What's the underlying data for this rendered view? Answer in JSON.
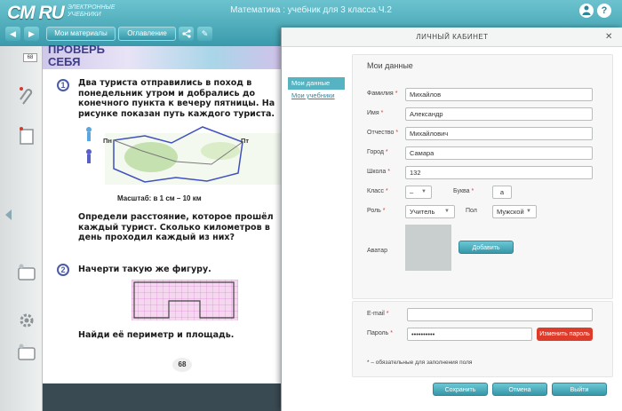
{
  "app": {
    "logo": "СМ RU",
    "logo_sub": "ЭЛЕКТРОННЫЕ УЧЕБНИКИ",
    "title": "Математика : учебник для 3 класса.Ч.2",
    "user_icon": "user-icon",
    "help_icon": "help-icon",
    "help_glyph": "?"
  },
  "toolbar": {
    "back_glyph": "◀",
    "forward_glyph": "▶",
    "my_materials": "Мои материалы",
    "contents": "Оглавление",
    "share_glyph": "<",
    "tools_glyph": "✎"
  },
  "sidebar": {
    "page_badge": "68"
  },
  "book": {
    "header": "ПРОВЕРЬ СЕБЯ",
    "task1_num": "1",
    "task1_text": "Два туриста отправились в поход в понедельник утром и добрались до конечного пункта к вечеру пятницы. На рисунке показан путь каждого туриста.",
    "label_start": "Пн",
    "label_end": "Пт",
    "scale": "Масштаб: в 1 см – 10 км",
    "task1_q": "Определи расстояние, которое прошёл каждый турист. Сколько километров в день проходил каждый из них?",
    "task2_num": "2",
    "task2_text": "Начерти такую же фигуру.",
    "task2_q": "Найди её периметр и площадь.",
    "page_number": "68"
  },
  "modal": {
    "title": "ЛИЧНЫЙ КАБИНЕТ",
    "close_glyph": "✕",
    "tabs": [
      {
        "label": "Мои данные"
      },
      {
        "label": "Мои учебники"
      }
    ],
    "section_title": "Мои данные",
    "required_mark": "*",
    "fields": {
      "surname_label": "Фамилия",
      "surname_value": "Михайлов",
      "name_label": "Имя",
      "name_value": "Александр",
      "patronymic_label": "Отчество",
      "patronymic_value": "Михайлович",
      "city_label": "Город",
      "city_value": "Самара",
      "school_label": "Школа",
      "school_value": "132",
      "class_label": "Класс",
      "class_value": "–",
      "letter_label": "Буква",
      "letter_value": "а",
      "role_label": "Роль",
      "role_value": "Учитель",
      "gender_label": "Пол",
      "gender_value": "Мужской",
      "avatar_label": "Аватар",
      "add_button": "Добавить",
      "email_label": "E-mail",
      "email_value": "",
      "password_label": "Пароль",
      "password_value": "••••••••••",
      "change_password": "Изменить пароль"
    },
    "note": "* – обязательные для заполнения поля",
    "buttons": {
      "save": "Сохранить",
      "cancel": "Отмена",
      "logout": "Выйти"
    }
  },
  "colors": {
    "accent": "#3a9aab",
    "danger": "#de3b2a",
    "tab_active": "#56b3c2"
  }
}
